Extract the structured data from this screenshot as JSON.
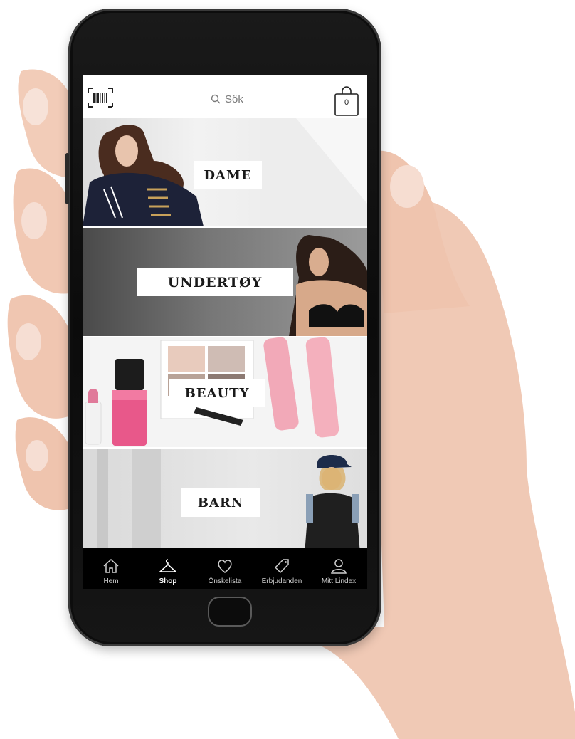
{
  "topbar": {
    "search_placeholder": "Sök",
    "cart_count": "0",
    "icons": [
      "barcode-icon",
      "search-icon",
      "shopping-bag-icon"
    ]
  },
  "categories": [
    {
      "label": "DAME"
    },
    {
      "label": "UNDERTØY"
    },
    {
      "label": "BEAUTY"
    },
    {
      "label": "BARN"
    }
  ],
  "tabbar": {
    "active": "Shop",
    "items": [
      {
        "label": "Hem",
        "icon": "home-icon"
      },
      {
        "label": "Shop",
        "icon": "hanger-icon"
      },
      {
        "label": "Önskelista",
        "icon": "heart-icon"
      },
      {
        "label": "Erbjudanden",
        "icon": "tag-icon"
      },
      {
        "label": "Mitt Lindex",
        "icon": "user-icon"
      }
    ]
  },
  "colors": {
    "screen_bg": "#ffffff",
    "tabbar_bg": "#000000",
    "phone_body": "#111111"
  }
}
